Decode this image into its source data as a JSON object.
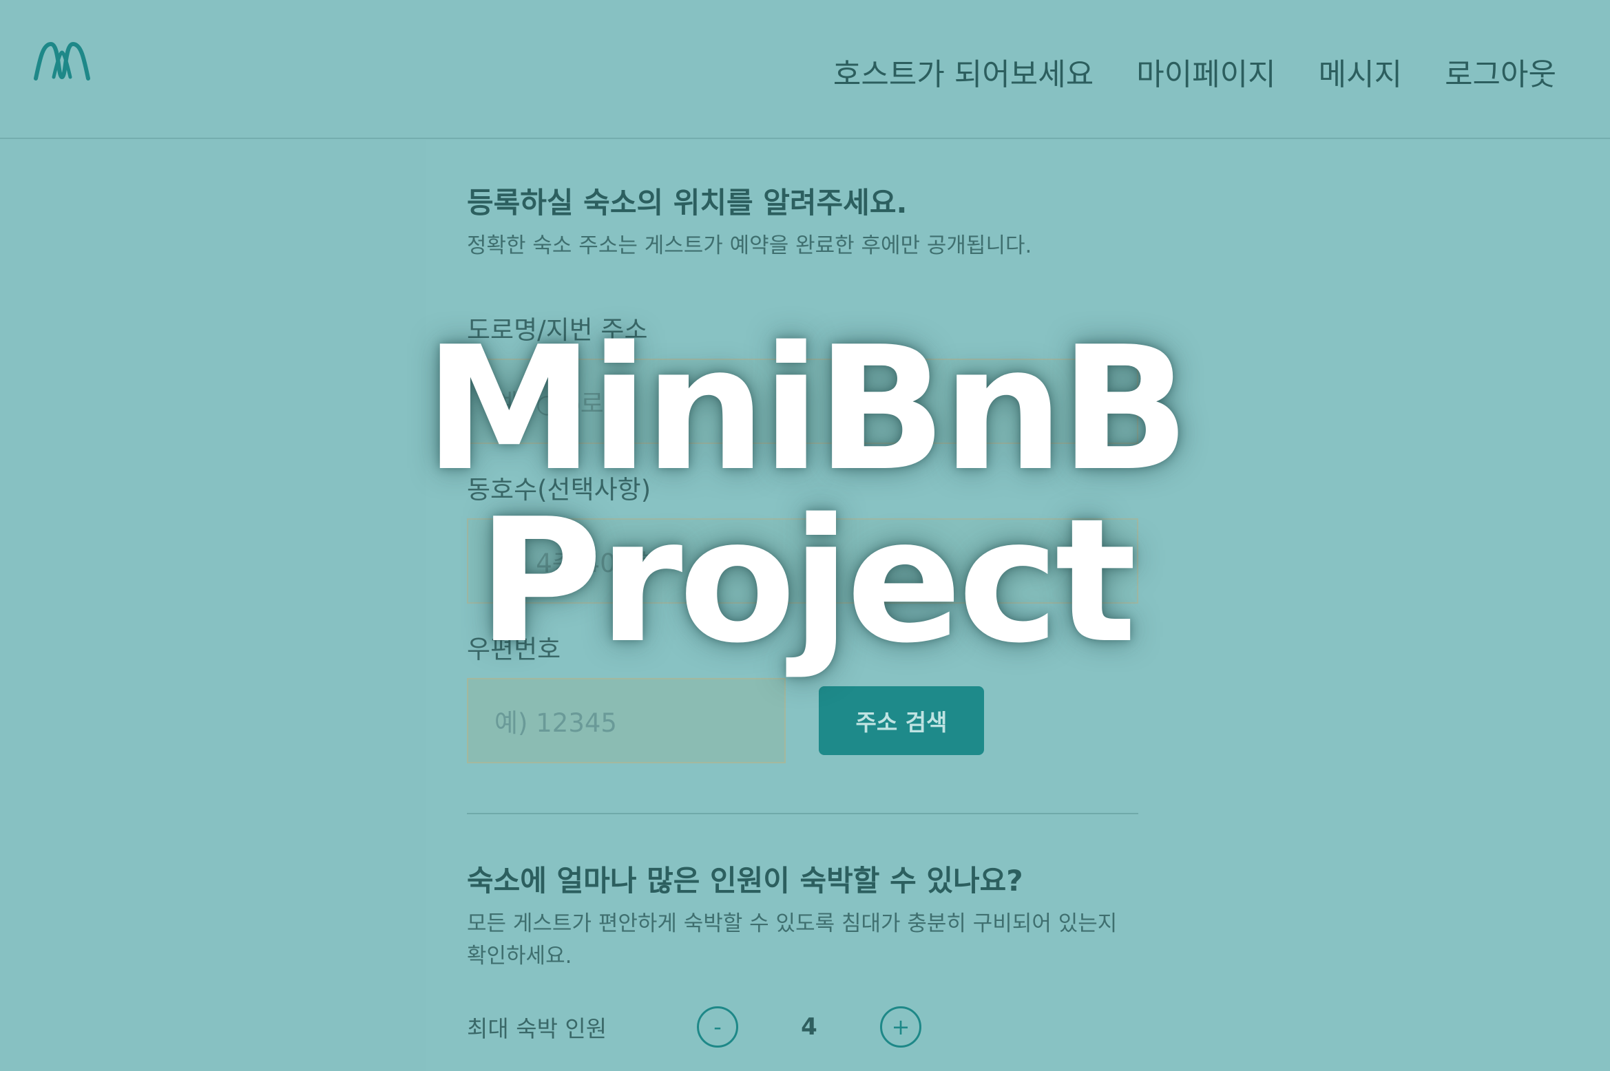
{
  "header": {
    "logo_icon": "minibnb-logo-icon",
    "nav": [
      {
        "label": "호스트가 되어보세요"
      },
      {
        "label": "마이페이지"
      },
      {
        "label": "메시지"
      },
      {
        "label": "로그아웃"
      }
    ]
  },
  "location": {
    "title": "등록하실 숙소의 위치를 알려주세요.",
    "subtitle": "정확한 숙소 주소는 게스트가 예약을 완료한 후에만 공개됩니다.",
    "address_label": "도로명/지번 주소",
    "address_placeholder": "예) ○○로 4",
    "detail_label": "동호수(선택사항)",
    "detail_placeholder": "예) 4층 407호",
    "zip_label": "우편번호",
    "zip_placeholder": "예) 12345",
    "search_button": "주소 검색"
  },
  "guests": {
    "title": "숙소에 얼마나 많은 인원이 숙박할 수 있나요?",
    "subtitle": "모든 게스트가 편안하게 숙박할 수 있도록 침대가 충분히 구비되어 있는지 확인하세요.",
    "max_label": "최대 숙박 인원",
    "count": "4",
    "minus": "-",
    "plus": "+"
  },
  "overlay": {
    "line1": "MiniBnB",
    "line2": "Project"
  },
  "colors": {
    "background": "#87c1c2",
    "accent": "#1e8a8a",
    "overlay_text": "#ffffff"
  }
}
